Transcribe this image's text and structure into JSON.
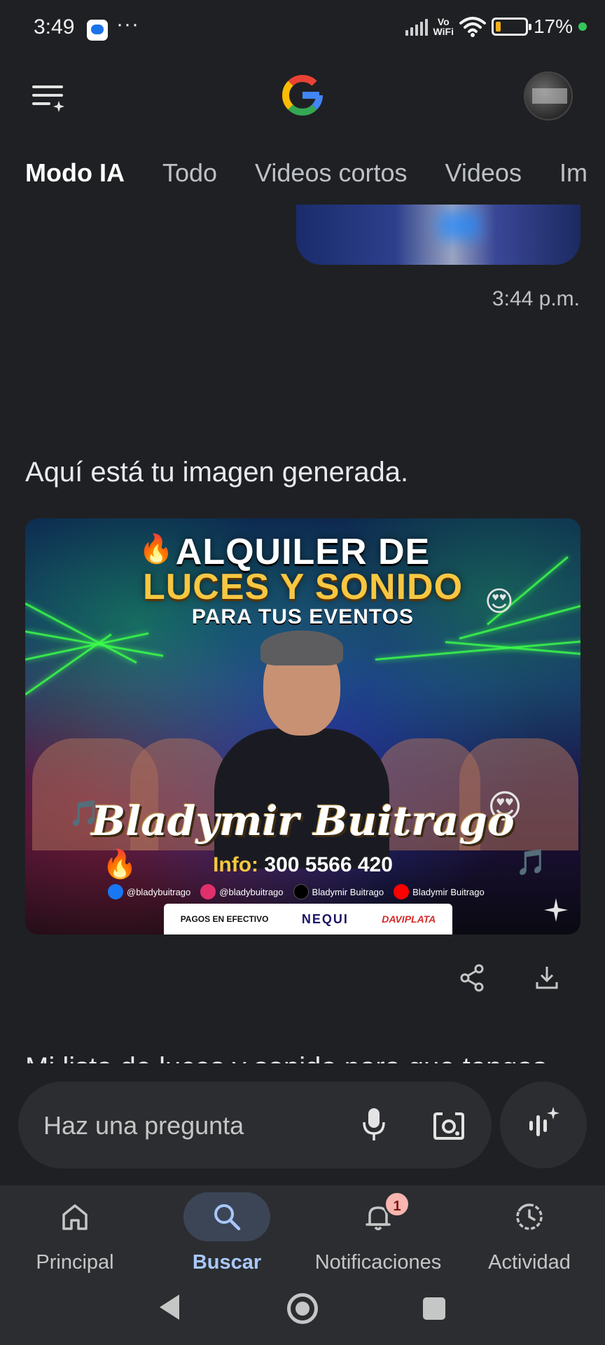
{
  "status_bar": {
    "time": "3:49",
    "dots": "···",
    "vowifi_line1": "Vo",
    "vowifi_line2": "WiFi",
    "battery_percent": "17%",
    "battery_level": 0.17
  },
  "header": {
    "menu_icon": "menu-sparkle-icon",
    "logo_icon": "google-g-icon",
    "avatar_icon": "profile-avatar"
  },
  "tabs": [
    {
      "label": "Modo IA",
      "active": true
    },
    {
      "label": "Todo",
      "active": false
    },
    {
      "label": "Videos cortos",
      "active": false
    },
    {
      "label": "Videos",
      "active": false
    },
    {
      "label": "Im",
      "active": false
    }
  ],
  "chat": {
    "user_message_time": "3:44 p.m.",
    "reply_text": "Aquí está tu imagen generada.",
    "cutoff_text": "Mi lista de luces y sonido para que tengas"
  },
  "flyer": {
    "title_line1": "ALQUILER DE",
    "title_line2": "LUCES Y SONIDO",
    "title_line3": "PARA TUS EVENTOS",
    "name": "Bladymir Buitrago",
    "info_label": "Info:",
    "info_phone": "300 5566 420",
    "socials": [
      {
        "icon": "facebook-icon",
        "handle": "@bladybuitrago",
        "color": "#1877f2"
      },
      {
        "icon": "instagram-icon",
        "handle": "@bladybuitrago",
        "color": "#e1306c"
      },
      {
        "icon": "tiktok-icon",
        "handle": "Bladymir Buitrago",
        "color": "#000000"
      },
      {
        "icon": "youtube-icon",
        "handle": "Bladymir Buitrago",
        "color": "#ff0000"
      }
    ],
    "payments": {
      "cash": "PAGOS EN EFECTIVO",
      "nequi": "NEQUI",
      "daviplata": "DAVIPLATA"
    }
  },
  "actions": {
    "share_icon": "share-icon",
    "download_icon": "download-icon"
  },
  "input": {
    "placeholder": "Haz una pregunta",
    "mic_icon": "mic-icon",
    "lens_icon": "google-lens-icon",
    "voice_icon": "ai-voice-icon"
  },
  "bottom_nav": [
    {
      "label": "Principal",
      "icon": "home-icon",
      "active": false
    },
    {
      "label": "Buscar",
      "icon": "search-icon",
      "active": true
    },
    {
      "label": "Notificaciones",
      "icon": "bell-icon",
      "active": false,
      "badge": "1"
    },
    {
      "label": "Actividad",
      "icon": "activity-icon",
      "active": false
    }
  ],
  "colors": {
    "background": "#1f2023",
    "active_nav": "#a8c7fa",
    "accent_gold": "#f7c742",
    "battery": "#f2b01e"
  }
}
